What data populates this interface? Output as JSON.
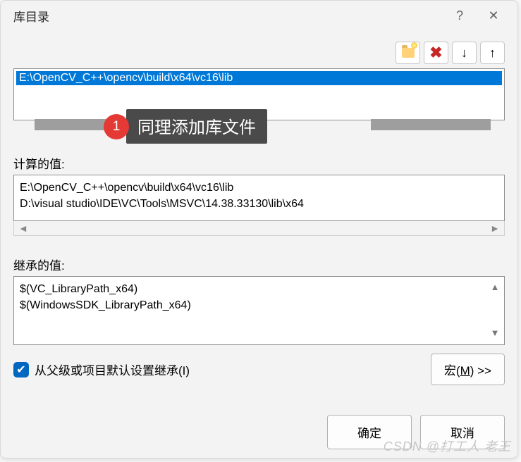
{
  "dialog": {
    "title": "库目录",
    "help_glyph": "?",
    "close_glyph": "✕"
  },
  "toolbar": {
    "new_folder_name": "new-folder",
    "delete_name": "delete",
    "down_name": "move-down",
    "up_name": "move-up"
  },
  "list": {
    "selected_path": "E:\\OpenCV_C++\\opencv\\build\\x64\\vc16\\lib"
  },
  "callout": {
    "number": "1",
    "text": "同理添加库文件"
  },
  "calculated": {
    "label": "计算的值:",
    "line1": "E:\\OpenCV_C++\\opencv\\build\\x64\\vc16\\lib",
    "line2": "D:\\visual studio\\IDE\\VC\\Tools\\MSVC\\14.38.33130\\lib\\x64"
  },
  "inherited": {
    "label": "继承的值:",
    "line1": "$(VC_LibraryPath_x64)",
    "line2": "$(WindowsSDK_LibraryPath_x64)"
  },
  "inherit_checkbox": {
    "label": "从父级或项目默认设置继承(I)",
    "checked": true
  },
  "buttons": {
    "macro": "宏(",
    "macro_u": "M",
    "macro_tail": ") >>",
    "ok": "确定",
    "cancel": "取消"
  },
  "watermark": "CSDN @打工人 老王"
}
